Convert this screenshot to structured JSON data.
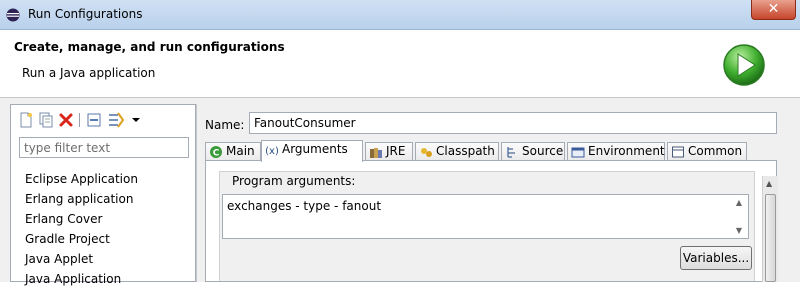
{
  "window": {
    "title": "Run Configurations",
    "close_label": "✕"
  },
  "header": {
    "title": "Create, manage, and run configurations",
    "subtitle": "Run a Java application",
    "banner_icon": "run-icon"
  },
  "left": {
    "toolbar_icons": [
      "new-configuration-icon",
      "duplicate-icon",
      "delete-icon",
      "collapse-all-icon",
      "filter-icon",
      "view-menu-icon"
    ],
    "filter_placeholder": "type filter text",
    "items": [
      "Eclipse Application",
      "Erlang application",
      "Erlang Cover",
      "Gradle Project",
      "Java Applet",
      "Java Application"
    ]
  },
  "config": {
    "name_label": "Name:",
    "name_value": "FanoutConsumer",
    "tabs": [
      {
        "label": "Main",
        "icon": "main-class-icon"
      },
      {
        "label": "Arguments",
        "icon": "arguments-icon"
      },
      {
        "label": "JRE",
        "icon": "jre-library-icon"
      },
      {
        "label": "Classpath",
        "icon": "classpath-icon"
      },
      {
        "label": "Source",
        "icon": "source-icon"
      },
      {
        "label": "Environment",
        "icon": "environment-icon"
      },
      {
        "label": "Common",
        "icon": "common-icon"
      }
    ],
    "active_tab": "Arguments",
    "program_args_label": "Program arguments:",
    "program_args_value": "exchanges - type - fanout",
    "variables_label": "Variables..."
  },
  "colors": {
    "run_green": "#2f9b2f",
    "delete_red": "#d9261c",
    "close_red": "#c7452b"
  }
}
